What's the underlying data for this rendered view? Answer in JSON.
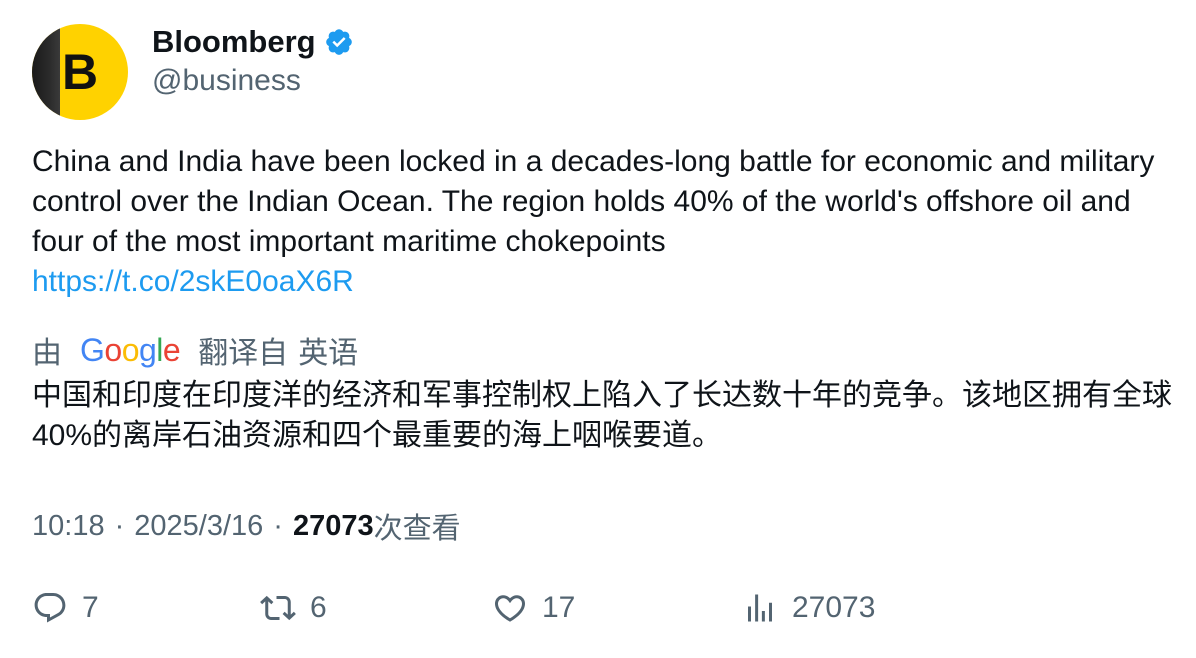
{
  "author": {
    "name": "Bloomberg",
    "handle": "@business",
    "avatar_letter": "B",
    "verified_icon": "verified-badge-icon"
  },
  "tweet": {
    "text": "China and India have been locked in a decades-long battle for economic and military control over the Indian Ocean. The region holds 40% of the world's offshore oil and four of the most important maritime chokepoints",
    "link": "https://t.co/2skE0oaX6R"
  },
  "translation": {
    "prefix": "由",
    "provider": "Google",
    "label": "翻译自",
    "language": "英语",
    "text": "中国和印度在印度洋的经济和军事控制权上陷入了长达数十年的竞争。该地区拥有全球40%的离岸石油资源和四个最重要的海上咽喉要道。"
  },
  "meta": {
    "time": "10:18",
    "separator": "·",
    "date": "2025/3/16",
    "views_count": "27073",
    "views_label": "次查看"
  },
  "actions": {
    "replies": "7",
    "retweets": "6",
    "likes": "17",
    "views": "27073"
  },
  "colors": {
    "link": "#1d9bf0",
    "muted": "#536471",
    "text": "#0f1419",
    "verified": "#1d9bf0",
    "avatar_bg": "#ffd200"
  }
}
